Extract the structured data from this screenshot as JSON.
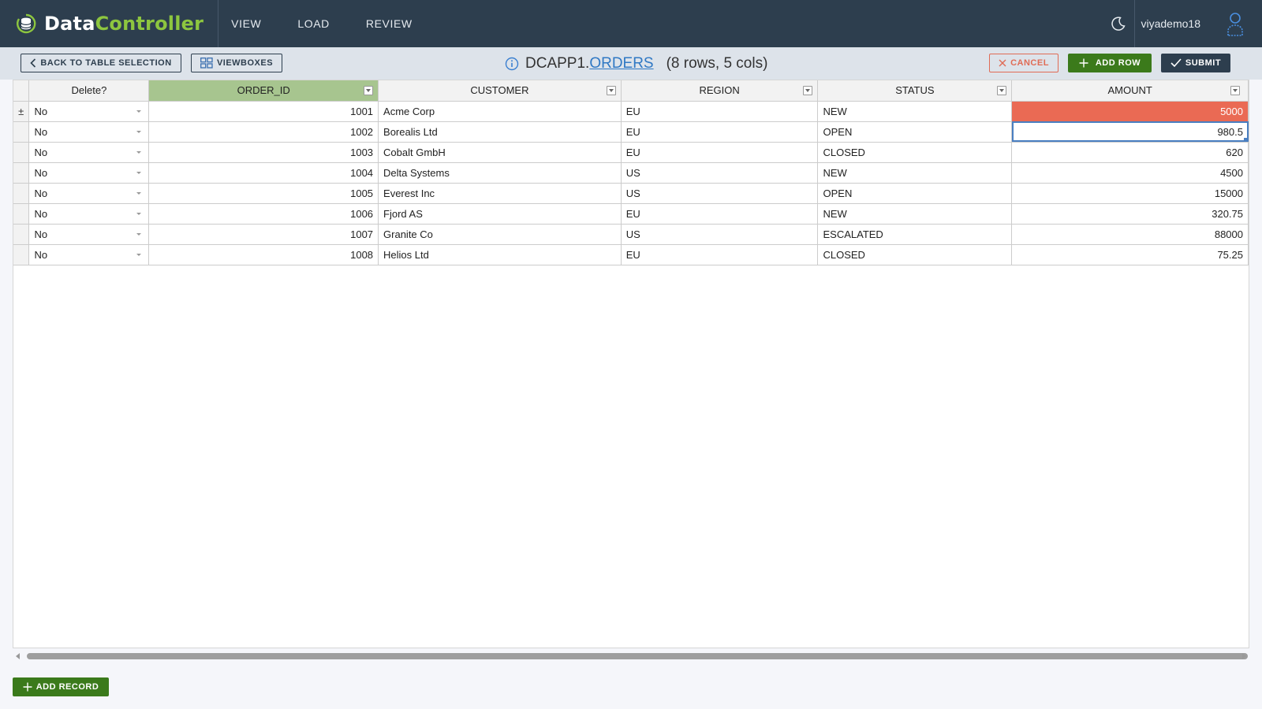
{
  "brand": {
    "name_part1": "Data",
    "name_part2": "Controller",
    "accent": "#8dc63f",
    "header_bg": "#2d3e4e"
  },
  "nav": [
    {
      "label": "VIEW"
    },
    {
      "label": "LOAD"
    },
    {
      "label": "REVIEW"
    }
  ],
  "header": {
    "theme_icon": "moon-icon",
    "username": "viyademo18",
    "avatar_icon": "user-icon"
  },
  "toolbar": {
    "back_label": "BACK TO TABLE SELECTION",
    "viewboxes_label": "VIEWBOXES",
    "library": "DCAPP1.",
    "table": "ORDERS",
    "dims": "(8 rows, 5 cols)",
    "cancel_label": "CANCEL",
    "add_row_label": "ADD ROW",
    "submit_label": "SUBMIT"
  },
  "grid": {
    "columns": [
      "Delete?",
      "ORDER_ID",
      "CUSTOMER",
      "REGION",
      "STATUS",
      "AMOUNT"
    ],
    "selected_column": "ORDER_ID",
    "first_row_marker": "±",
    "rows": [
      {
        "delete": "No",
        "order_id": "1001",
        "customer": "Acme Corp",
        "region": "EU",
        "status": "NEW",
        "amount": "5000"
      },
      {
        "delete": "No",
        "order_id": "1002",
        "customer": "Borealis Ltd",
        "region": "EU",
        "status": "OPEN",
        "amount": "980.5"
      },
      {
        "delete": "No",
        "order_id": "1003",
        "customer": "Cobalt GmbH",
        "region": "EU",
        "status": "CLOSED",
        "amount": "620"
      },
      {
        "delete": "No",
        "order_id": "1004",
        "customer": "Delta Systems",
        "region": "US",
        "status": "NEW",
        "amount": "4500"
      },
      {
        "delete": "No",
        "order_id": "1005",
        "customer": "Everest Inc",
        "region": "US",
        "status": "OPEN",
        "amount": "15000"
      },
      {
        "delete": "No",
        "order_id": "1006",
        "customer": "Fjord AS",
        "region": "EU",
        "status": "NEW",
        "amount": "320.75"
      },
      {
        "delete": "No",
        "order_id": "1007",
        "customer": "Granite Co",
        "region": "US",
        "status": "ESCALATED",
        "amount": "88000"
      },
      {
        "delete": "No",
        "order_id": "1008",
        "customer": "Helios Ltd",
        "region": "EU",
        "status": "CLOSED",
        "amount": "75.25"
      }
    ],
    "highlight_color": "#ea6a54"
  },
  "footer": {
    "add_record_label": "ADD RECORD"
  }
}
